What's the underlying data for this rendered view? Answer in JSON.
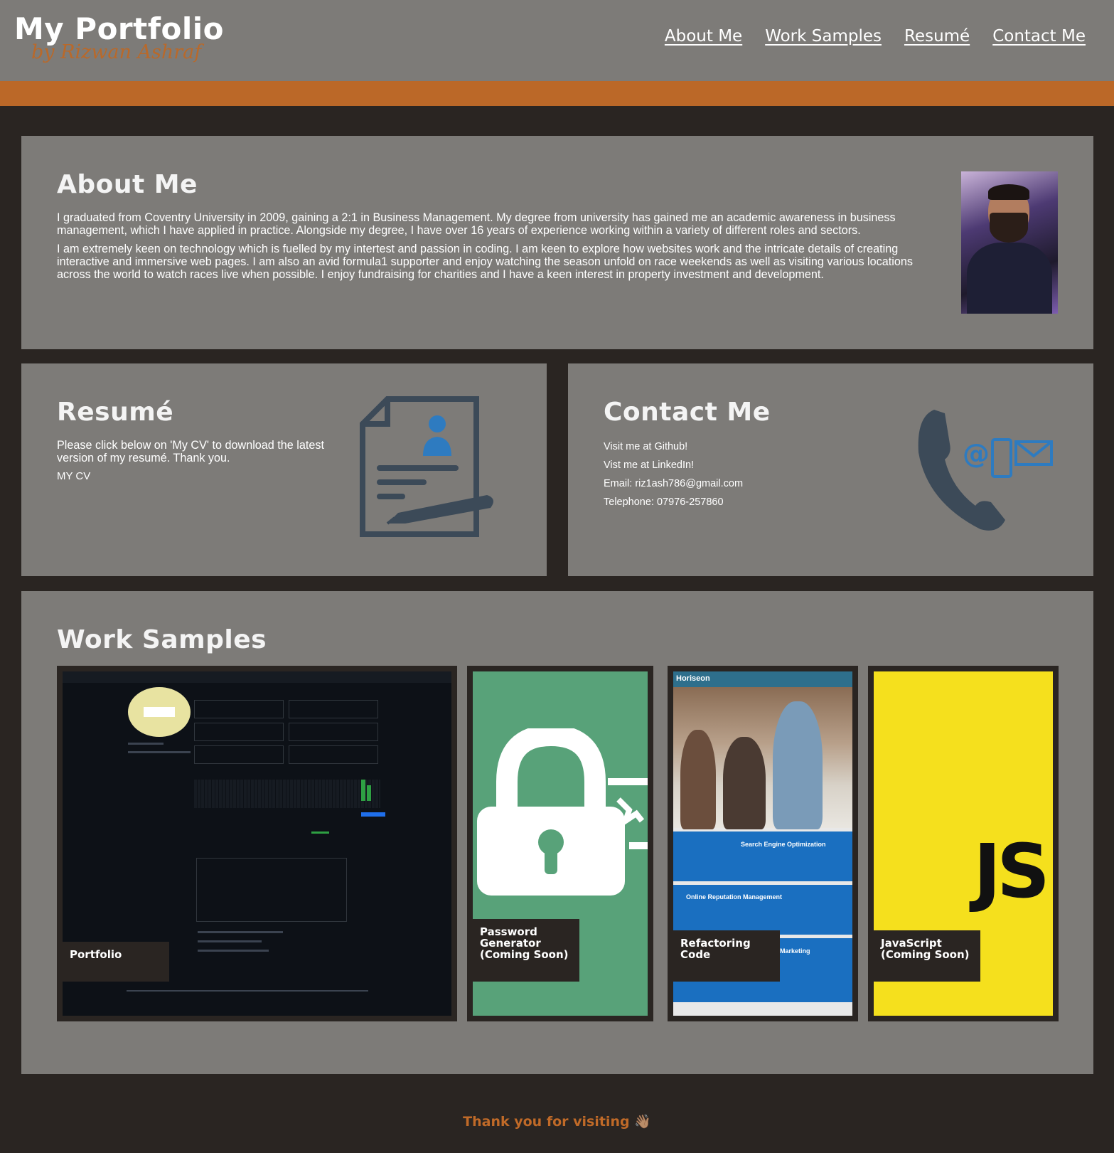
{
  "header": {
    "title": "My Portfolio",
    "subtitle": "by Rizwan Ashraf",
    "nav": [
      "About Me",
      "Work Samples",
      "Resumé",
      "Contact Me"
    ]
  },
  "about": {
    "heading": "About Me",
    "paragraphs": [
      "I graduated from Coventry University in 2009, gaining a 2:1 in Business Management. My degree from university has gained me an academic awareness in business management, which I have applied in practice. Alongside my degree, I have over 16 years of experience working within a variety of different roles and sectors.",
      "I am extremely keen on technology which is fuelled by my intertest and passion in coding. I am keen to explore how websites work and the intricate details of creating interactive and immersive web pages. I am also an avid formula1 supporter and enjoy watching the season unfold on race weekends as well as visiting various locations across the world to watch races live when possible. I enjoy fundraising for charities and I have a keen interest in property investment and development."
    ]
  },
  "resume": {
    "heading": "Resumé",
    "text": "Please click below on 'My CV' to download the latest version of my resumé. Thank you.",
    "link": "MY CV"
  },
  "contact": {
    "heading": "Contact Me",
    "github": "Visit me at Github!",
    "linkedin": "Vist me at LinkedIn!",
    "email": "Email: riz1ash786@gmail.com",
    "telephone": "Telephone: 07976-257860"
  },
  "work": {
    "heading": "Work Samples",
    "cards": [
      {
        "label": "Portfolio"
      },
      {
        "label": "Password Generator (Coming Soon)"
      },
      {
        "label": "Refactoring Code"
      },
      {
        "label": "JavaScript (Coming Soon)"
      }
    ],
    "horiseon_brand": "Horiseon",
    "horiseon_seo": "Search Engine Optimization",
    "horiseon_orm": "Online Reputation Management",
    "horiseon_marketing": "Marketing",
    "js_logo": "JS"
  },
  "footer": {
    "text": "Thank you for visiting 👋🏽"
  },
  "colors": {
    "header_bg": "#7d7b78",
    "accent_orange": "#bb6828",
    "page_bg": "#2a2522",
    "icon_slate": "#3c4a58",
    "icon_blue": "#2e7bc0"
  }
}
